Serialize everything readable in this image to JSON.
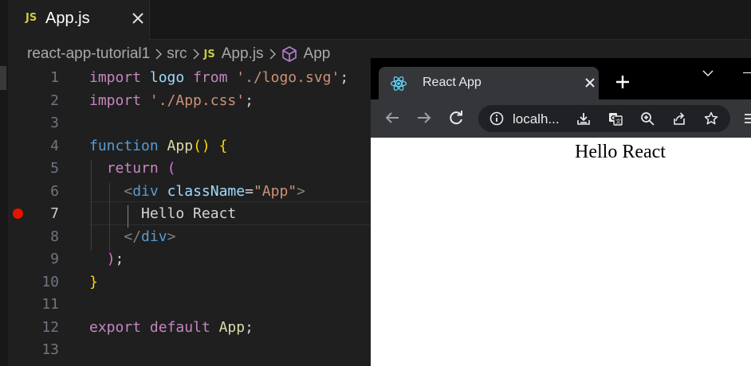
{
  "editor": {
    "tab": {
      "badge": "JS",
      "filename": "App.js"
    },
    "breadcrumb": {
      "project": "react-app-tutorial1",
      "folder": "src",
      "file_badge": "JS",
      "file": "App.js",
      "symbol": "App"
    },
    "line_numbers": [
      "1",
      "2",
      "3",
      "4",
      "5",
      "6",
      "7",
      "8",
      "9",
      "10",
      "11",
      "12",
      "13"
    ],
    "active_line": "7",
    "breakpoint_line": "7",
    "code": {
      "l1": {
        "kw_import": "import",
        "id": "logo",
        "kw_from": "from",
        "str": "'./logo.svg'",
        "end": ";"
      },
      "l2": {
        "kw_import": "import",
        "str": "'./App.css'",
        "end": ";"
      },
      "l4": {
        "kw_function": "function",
        "name": "App",
        "parens": "()",
        "brace": "{"
      },
      "l5": {
        "kw_return": "return",
        "paren": "("
      },
      "l6": {
        "open": "<",
        "tag": "div",
        "attr": "className",
        "eq": "=",
        "val": "\"App\"",
        "close": ">"
      },
      "l7": {
        "text": "Hello React"
      },
      "l8": {
        "open": "</",
        "tag": "div",
        "close": ">"
      },
      "l9": {
        "paren": ")",
        "end": ";"
      },
      "l10": {
        "brace": "}"
      },
      "l12": {
        "kw_export": "export",
        "kw_default": "default",
        "name": "App",
        "end": ";"
      }
    }
  },
  "browser": {
    "tab_title": "React App",
    "url": "localh...",
    "page_text": "Hello React"
  },
  "icons": {
    "tab_close": "close-icon",
    "breadcrumb_sep": "chevron-right-icon",
    "symbol": "cube-icon",
    "favicon": "react-logo-icon",
    "new_tab": "plus-icon",
    "tab_search": "chevron-down-icon",
    "back": "arrow-left-icon",
    "forward": "arrow-right-icon",
    "reload": "reload-icon",
    "site_info": "info-icon",
    "install": "install-icon",
    "translate": "translate-icon",
    "zoom": "zoom-in-icon",
    "share": "share-icon",
    "bookmark": "star-icon",
    "menu": "kebab-menu-icon"
  },
  "colors": {
    "editor_bg": "#1f1f1f",
    "keyword": "#c586c0",
    "string": "#ce9178",
    "function": "#dcdcaa",
    "variable": "#9cdcfe",
    "tag": "#569cd6",
    "breakpoint": "#e51400",
    "browser_chrome": "#35363a"
  }
}
